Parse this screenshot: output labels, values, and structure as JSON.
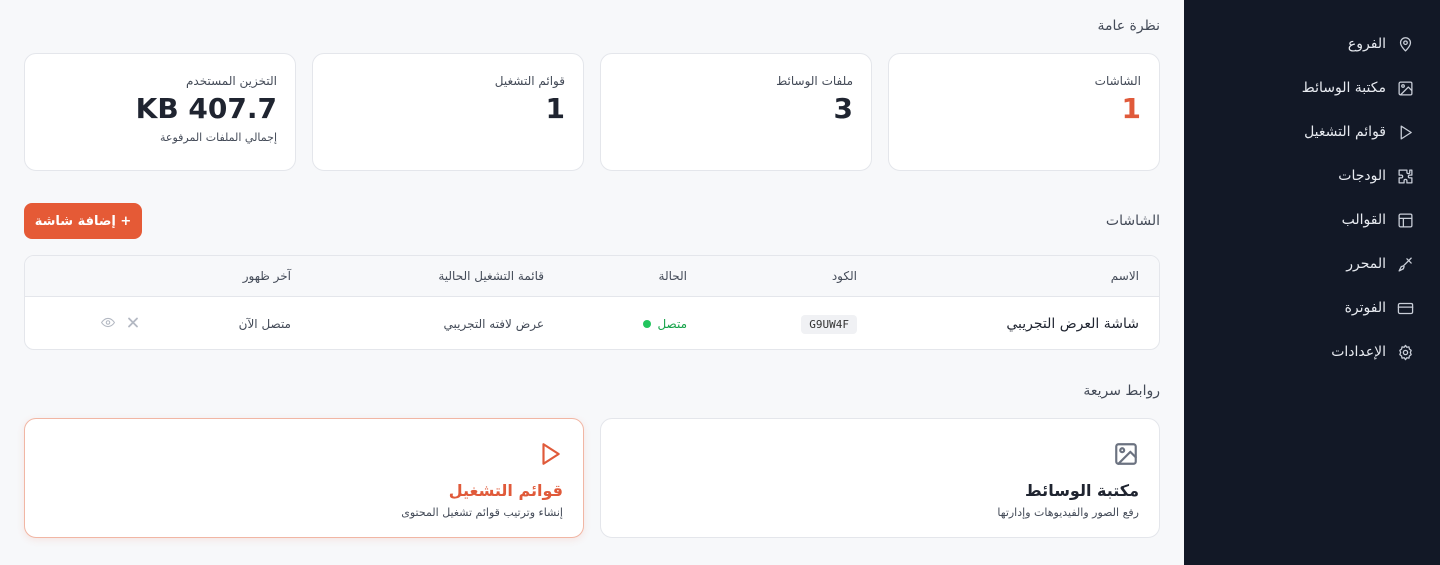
{
  "sidebar": {
    "items": [
      {
        "label": "الفروع",
        "icon": "map-pin-icon"
      },
      {
        "label": "مكتبة الوسائط",
        "icon": "image-icon"
      },
      {
        "label": "قوائم التشغيل",
        "icon": "play-icon"
      },
      {
        "label": "الودجات",
        "icon": "puzzle-icon"
      },
      {
        "label": "القوالب",
        "icon": "layout-icon"
      },
      {
        "label": "المحرر",
        "icon": "brush-icon"
      },
      {
        "label": "الفوترة",
        "icon": "credit-card-icon"
      },
      {
        "label": "الإعدادات",
        "icon": "gear-icon"
      }
    ]
  },
  "overview": {
    "title": "نظرة عامة",
    "cards": [
      {
        "label": "الشاشات",
        "value": "1",
        "sub": ""
      },
      {
        "label": "ملفات الوسائط",
        "value": "3",
        "sub": ""
      },
      {
        "label": "قوائم التشغيل",
        "value": "1",
        "sub": ""
      },
      {
        "label": "التخزين المستخدم",
        "value": "407.7 KB",
        "sub": "إجمالي الملفات المرفوعة"
      }
    ],
    "accent": "#e05a3a"
  },
  "screens": {
    "title": "الشاشات",
    "add_label": "+ إضافة شاشة",
    "columns": {
      "name": "الاسم",
      "code": "الكود",
      "status": "الحالة",
      "playlist": "قائمة التشغيل الحالية",
      "last_seen": "آخر ظهور"
    },
    "rows": [
      {
        "name": "شاشة العرض التجريبي",
        "code": "G9UW4F",
        "status": "متصل",
        "playlist": "عرض لافته التجريبي",
        "last_seen": "متصل الآن"
      }
    ]
  },
  "quick_links": {
    "title": "روابط سريعة",
    "items": [
      {
        "title": "مكتبة الوسائط",
        "desc": "رفع الصور والفيديوهات وإدارتها",
        "icon": "image-icon"
      },
      {
        "title": "قوائم التشغيل",
        "desc": "إنشاء وترتيب قوائم تشغيل المحتوى",
        "icon": "play-icon"
      }
    ]
  }
}
